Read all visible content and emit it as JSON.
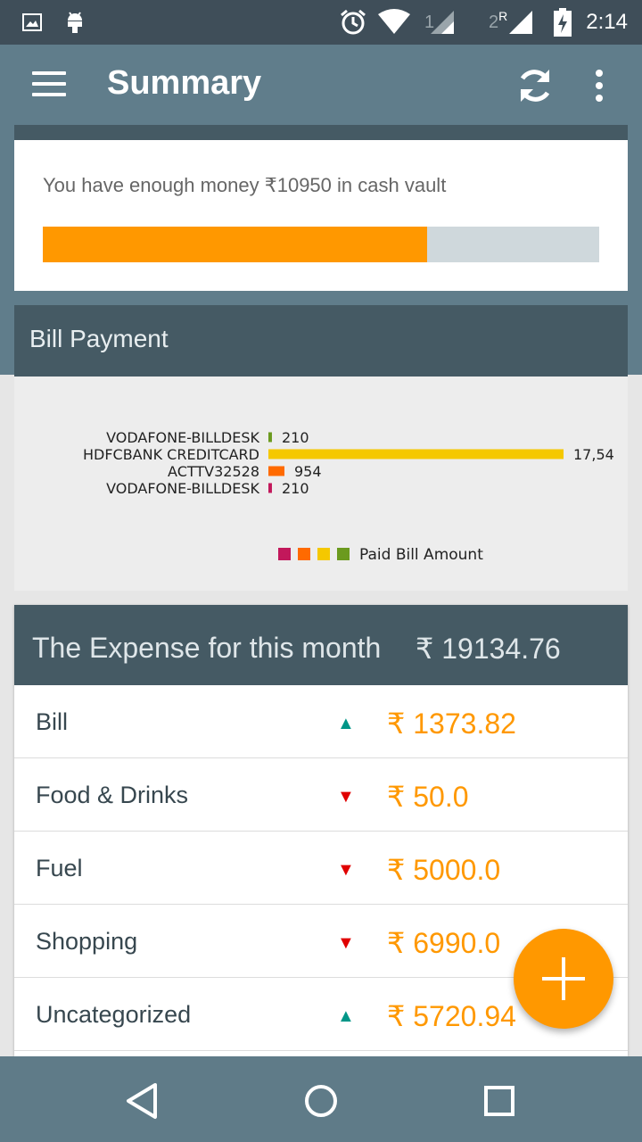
{
  "status_bar": {
    "time": "2:14",
    "sim1": "1",
    "sim2": "2",
    "sim2_roaming": "R",
    "icons": [
      "image-icon",
      "android-icon",
      "alarm-icon",
      "wifi-icon",
      "signal-icon",
      "battery-charging-icon"
    ]
  },
  "app_bar": {
    "title": "Summary",
    "menu_icon": "hamburger-menu-icon",
    "refresh_icon": "refresh-icon",
    "overflow_icon": "more-vert-icon"
  },
  "vault": {
    "text": "You have enough money ₹10950 in cash vault",
    "progress": 0.69
  },
  "bill_payment": {
    "title": "Bill Payment"
  },
  "chart_data": {
    "type": "bar",
    "orientation": "horizontal",
    "categories": [
      "VODAFONE-BILLDESK",
      "HDFCBANK CREDITCARD",
      "ACTTV32528",
      "VODAFONE-BILLDESK"
    ],
    "values": [
      210,
      17545,
      954,
      210
    ],
    "data_labels": [
      "210",
      "17,54",
      "954",
      "210"
    ],
    "colors": [
      "#6b9a1e",
      "#f5c800",
      "#ff6a00",
      "#c2185b"
    ],
    "legend": {
      "label": "Paid Bill Amount",
      "placement": "bottom",
      "colors": [
        "#c2185b",
        "#ff6a00",
        "#f5c800",
        "#6b9a1e"
      ]
    },
    "grid": false
  },
  "expense": {
    "title": "The Expense for this month",
    "total": "₹ 19134.76",
    "rows": [
      {
        "category": "Bill",
        "trend": "up",
        "arrow": "▲",
        "amount": "₹ 1373.82"
      },
      {
        "category": "Food & Drinks",
        "trend": "down",
        "arrow": "▼",
        "amount": "₹ 50.0"
      },
      {
        "category": "Fuel",
        "trend": "down",
        "arrow": "▼",
        "amount": "₹ 5000.0"
      },
      {
        "category": "Shopping",
        "trend": "down",
        "arrow": "▼",
        "amount": "₹ 6990.0"
      },
      {
        "category": "Uncategorized",
        "trend": "up",
        "arrow": "▲",
        "amount": "₹ 5720.94"
      }
    ]
  },
  "fab": {
    "icon": "plus-icon"
  },
  "nav_bar": {
    "back_icon": "back-icon",
    "home_icon": "home-icon",
    "recents_icon": "recents-icon"
  },
  "colors": {
    "primary": "#607d8b",
    "primary_dark": "#455a64",
    "accent": "#ff9800",
    "trend_up": "#009688",
    "trend_down": "#e00000"
  }
}
